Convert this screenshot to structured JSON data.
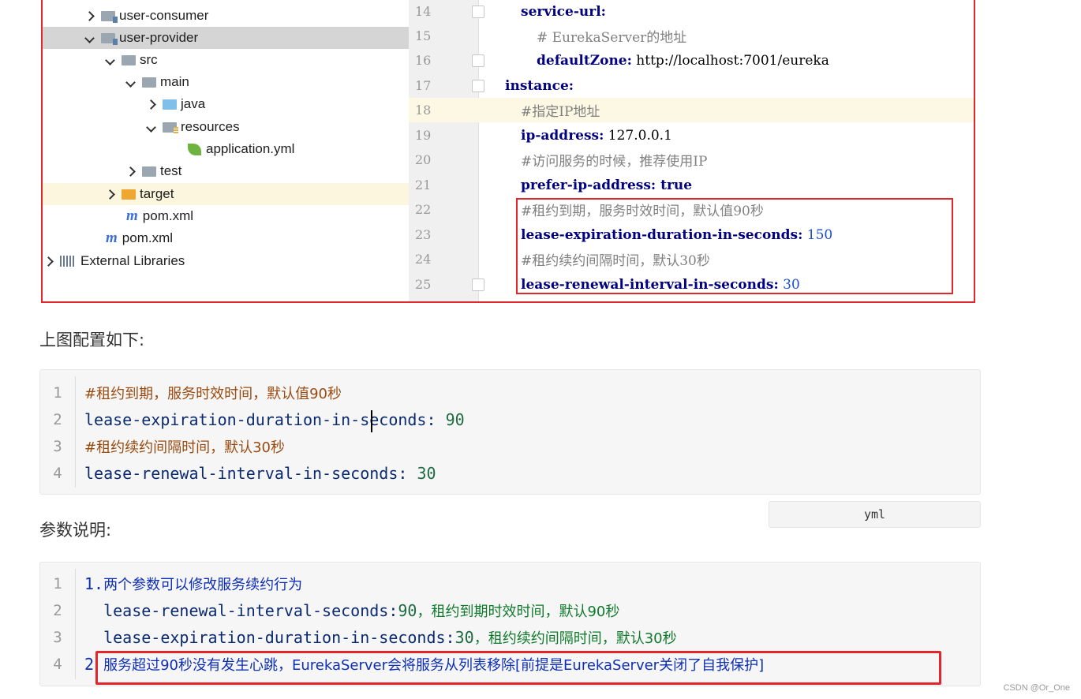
{
  "project_tree": {
    "items": [
      {
        "label": "user-consumer",
        "icon": "module-folder-icon",
        "expanded": false
      },
      {
        "label": "user-provider",
        "icon": "module-folder-icon",
        "expanded": true,
        "selected": true
      },
      {
        "label": "src",
        "icon": "folder-icon",
        "expanded": true
      },
      {
        "label": "main",
        "icon": "folder-icon",
        "expanded": true
      },
      {
        "label": "java",
        "icon": "source-folder-icon",
        "expanded": false
      },
      {
        "label": "resources",
        "icon": "resources-folder-icon",
        "expanded": true
      },
      {
        "label": "application.yml",
        "icon": "spring-leaf-icon"
      },
      {
        "label": "test",
        "icon": "folder-icon",
        "expanded": false
      },
      {
        "label": "target",
        "icon": "excluded-folder-icon",
        "expanded": false
      },
      {
        "label": "pom.xml",
        "icon": "maven-icon"
      },
      {
        "label": "pom.xml",
        "icon": "maven-icon"
      },
      {
        "label": "External Libraries",
        "icon": "libraries-icon",
        "expanded": false
      }
    ]
  },
  "editor": {
    "lines": [
      {
        "n": "14",
        "key": "service-url:",
        "val": "",
        "cmt": ""
      },
      {
        "n": "15",
        "key": "",
        "val": "",
        "cmt": "# EurekaServer的地址"
      },
      {
        "n": "16",
        "key": "defaultZone:",
        "val": " http://localhost:7001/eureka",
        "cmt": ""
      },
      {
        "n": "17",
        "key": "instance:",
        "val": "",
        "cmt": ""
      },
      {
        "n": "18",
        "key": "",
        "val": "",
        "cmt": "#指定IP地址"
      },
      {
        "n": "19",
        "key": "ip-address:",
        "val": " 127.0.0.1",
        "cmt": ""
      },
      {
        "n": "20",
        "key": "",
        "val": "",
        "cmt": "#访问服务的时候，推荐使用IP"
      },
      {
        "n": "21",
        "key": "prefer-ip-address:",
        "val": " true",
        "cmt": ""
      },
      {
        "n": "22",
        "key": "",
        "val": "",
        "cmt": "#租约到期，服务时效时间，默认值90秒"
      },
      {
        "n": "23",
        "key": "lease-expiration-duration-in-seconds:",
        "val": " 150",
        "cmt": ""
      },
      {
        "n": "24",
        "key": "",
        "val": "",
        "cmt": "#租约续约间隔时间，默认30秒"
      },
      {
        "n": "25",
        "key": "lease-renewal-interval-in-seconds:",
        "val": " 30",
        "cmt": ""
      }
    ]
  },
  "doc": {
    "heading1": "上图配置如下:",
    "heading2": "参数说明:",
    "block1": {
      "lines": [
        {
          "n": "1",
          "a": "#租约到期，服务时效时间，默认值90秒",
          "b": ""
        },
        {
          "n": "2",
          "a": "lease-expiration-duration-in-seconds:",
          "b": " 90"
        },
        {
          "n": "3",
          "a": "#租约续约间隔时间，默认30秒",
          "b": ""
        },
        {
          "n": "4",
          "a": "lease-renewal-interval-in-seconds:",
          "b": " 30"
        }
      ],
      "lang": "yml"
    },
    "block2": {
      "lines": [
        {
          "n": "1",
          "a": "1.",
          "b": "两个参数可以修改服务续约行为",
          "c": ""
        },
        {
          "n": "2",
          "a": "  lease-renewal-interval-seconds:",
          "b": "90",
          "c": "，租约到期时效时间，默认90秒"
        },
        {
          "n": "3",
          "a": "  lease-expiration-duration-in-seconds:",
          "b": "30",
          "c": "，租约续约间隔时间，默认30秒"
        },
        {
          "n": "4",
          "a": "2",
          "b": "服务超过90秒没有发生心跳，EurekaServer会将服务从列表移除[前提是EurekaServer关闭了自我保护]",
          "c": ""
        }
      ]
    }
  },
  "watermark": "CSDN @Or_One",
  "colors": {
    "highlight_border": "#e3262b",
    "yaml_key": "#000080",
    "yaml_number": "#1b4fcf"
  }
}
